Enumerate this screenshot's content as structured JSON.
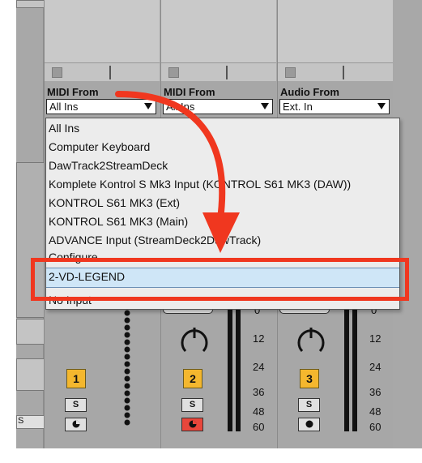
{
  "colors": {
    "panel": "#a8a8a8",
    "track_number": "#f4b72e",
    "highlight_box": "#f0371f",
    "dropdown_selected": "#cfe6f7",
    "record_arm_active": "#e8463b"
  },
  "tracks": [
    {
      "io_label": "MIDI From",
      "io_value": "All Ins",
      "number": "1",
      "solo": "S"
    },
    {
      "io_label": "MIDI From",
      "io_value": "All Ins",
      "number": "2",
      "solo": "S"
    },
    {
      "io_label": "Audio From",
      "io_value": "Ext. In",
      "number": "3",
      "solo": "S"
    }
  ],
  "dropdown": {
    "items": [
      "All Ins",
      "Computer Keyboard",
      "DawTrack2StreamDeck",
      "Komplete Kontrol S Mk3 Input (KONTROL S61 MK3 (DAW))",
      "KONTROL S61 MK3 (Ext)",
      "KONTROL S61 MK3 (Main)",
      "ADVANCE Input (StreamDeck2DawTrack)",
      "Configure...",
      "2-VD-LEGEND",
      "No Input"
    ],
    "selected": "2-VD-LEGEND"
  },
  "meter_scale": [
    "0",
    "12",
    "24",
    "36",
    "48",
    "60"
  ],
  "left_partial_label": "S",
  "icons": [
    "arrow-annotation-icon",
    "dropdown-arrow-icon",
    "pan-knob-icon",
    "record-arm-icon",
    "dotted-meter-icon"
  ]
}
